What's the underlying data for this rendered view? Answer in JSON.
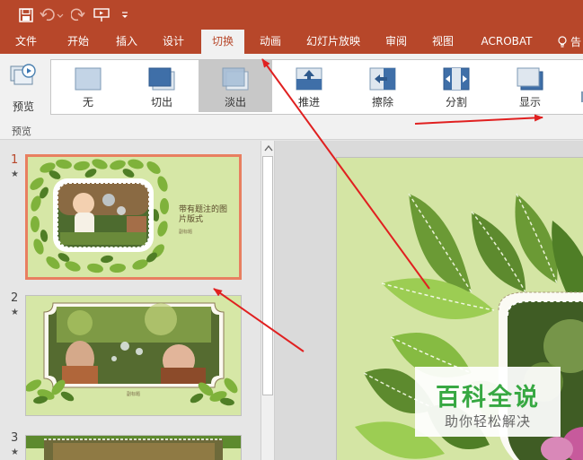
{
  "ribbon": {
    "tabs": [
      {
        "label": "文件"
      },
      {
        "label": "开始"
      },
      {
        "label": "插入"
      },
      {
        "label": "设计"
      },
      {
        "label": "切换",
        "active": true
      },
      {
        "label": "动画"
      },
      {
        "label": "幻灯片放映"
      },
      {
        "label": "审阅"
      },
      {
        "label": "视图"
      },
      {
        "label": "ACROBAT"
      }
    ],
    "help_label": "告",
    "preview_label": "预览",
    "group_label": "预览",
    "transitions": [
      {
        "label": "无",
        "icon": "none-transition-icon"
      },
      {
        "label": "切出",
        "icon": "cut-transition-icon"
      },
      {
        "label": "淡出",
        "icon": "fade-transition-icon",
        "selected": true
      },
      {
        "label": "推进",
        "icon": "push-transition-icon"
      },
      {
        "label": "擦除",
        "icon": "wipe-transition-icon"
      },
      {
        "label": "分割",
        "icon": "split-transition-icon"
      },
      {
        "label": "显示",
        "icon": "reveal-transition-icon"
      }
    ]
  },
  "slides": [
    {
      "number": "1",
      "title": "带有题注的图片版式",
      "caption": "副标题"
    },
    {
      "number": "2",
      "caption": "副标题"
    },
    {
      "number": "3"
    }
  ],
  "watermark": {
    "title": "百科全说",
    "subtitle": "助你轻松解决"
  },
  "colors": {
    "accent": "#b7472a",
    "selection_border": "#e87f60",
    "slide_bg": "#d6e7a6",
    "leaf_dark": "#5d8a2e",
    "leaf_light": "#8cbf3f",
    "watermark_green": "#37a842",
    "arrow_red": "#e02020"
  }
}
